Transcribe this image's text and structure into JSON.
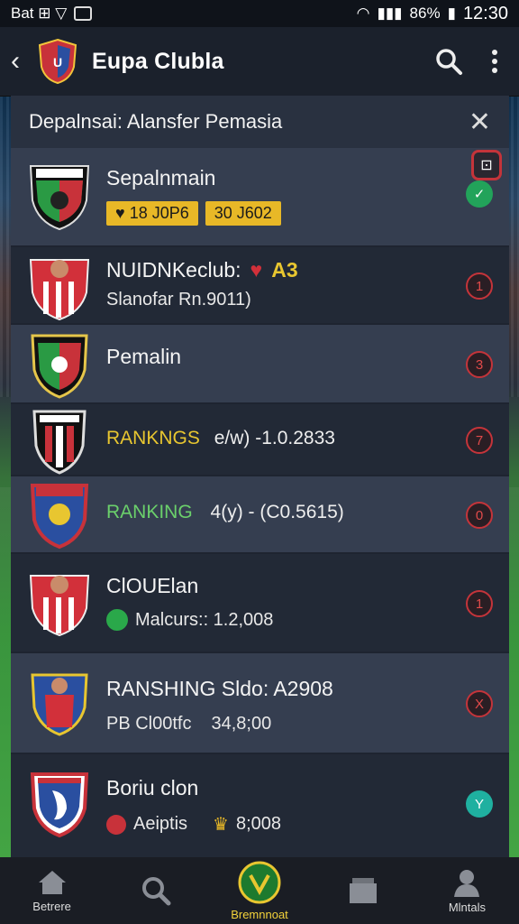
{
  "status": {
    "left": "Bat ⊞ ▽",
    "battery": "86%",
    "time": "12:30"
  },
  "header": {
    "title": "Eupa Clubla"
  },
  "panel": {
    "title": "Depalnsai: Alansfer Pemasia"
  },
  "rows": [
    {
      "name": "Sepalnmain",
      "chip1": "18 J0P6",
      "chip2": "30 J602",
      "badge": "✓"
    },
    {
      "name": "NUIDNKeclub:",
      "tag": "A3",
      "sub": "Slanofar Rn.9011)",
      "badge": "1"
    },
    {
      "name": "Pemalin",
      "badge": "3"
    },
    {
      "name": "RANKNGS",
      "value": "e/w) -1.0.2833",
      "badge": "7"
    },
    {
      "name": "RANKING",
      "value": "4(y) - (C0.5615)",
      "badge": "0"
    },
    {
      "name": "ClOUElan",
      "sub": "Malcurs:: 1.2,008",
      "badge": "1"
    },
    {
      "name": "RANSHING Sldo:  A2908",
      "sub_label": "PB Cl00tfc",
      "sub_value": "34,8;00",
      "badge": "X"
    },
    {
      "name": "Boriu clon",
      "sub_label": "Aeiptis",
      "sub_value": "8;008",
      "badge": "Y"
    }
  ],
  "nav": [
    {
      "label": "Betrere",
      "icon": "home-icon"
    },
    {
      "label": "",
      "icon": "search-icon"
    },
    {
      "label": "Bremnnoat",
      "icon": "club-badge-icon"
    },
    {
      "label": "",
      "icon": "inbox-icon"
    },
    {
      "label": "Mlntals",
      "icon": "user-icon"
    }
  ],
  "colors": {
    "accent": "#f3d23a",
    "ranking_yellow": "#e8c630",
    "ranking_green": "#6bd06b",
    "badge_red": "#c4343a"
  }
}
